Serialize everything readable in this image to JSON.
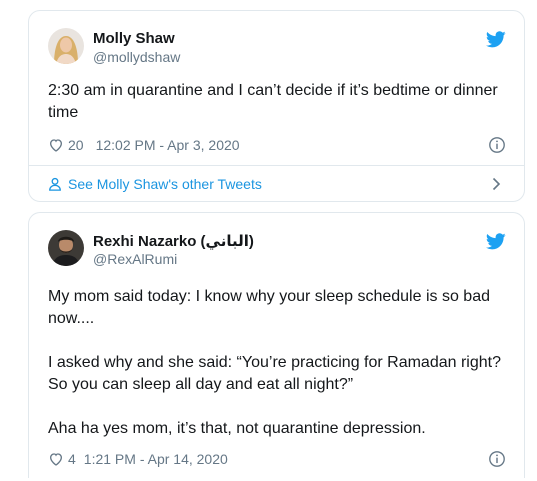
{
  "tweets": [
    {
      "author": {
        "name": "Molly Shaw",
        "handle": "@mollydshaw"
      },
      "text": [
        "2:30 am in quarantine and I can’t decide if it’s bedtime or dinner time"
      ],
      "likes": "20",
      "timestamp": "12:02 PM - Apr 3, 2020",
      "see_more": "See Molly Shaw's other Tweets"
    },
    {
      "author": {
        "name": "Rexhi Nazarko (الباني)",
        "handle": "@RexAlRumi"
      },
      "text": [
        "My mom said today: I know why your sleep schedule is so bad now....",
        "I asked why and she said: “You’re practicing for Ramadan right? So you can sleep all day and eat all night?”",
        "Aha ha yes mom, it’s that, not quarantine depression."
      ],
      "likes": "4",
      "timestamp": "1:21 PM - Apr 14, 2020"
    }
  ],
  "colors": {
    "twitter_blue": "#1da1f2",
    "link_blue": "#1b95e0",
    "text_primary": "#14171a",
    "text_secondary": "#657786",
    "border": "#e1e8ed"
  },
  "icons": [
    "twitter-bird-icon",
    "heart-icon",
    "info-icon",
    "person-icon",
    "chevron-right-icon"
  ]
}
